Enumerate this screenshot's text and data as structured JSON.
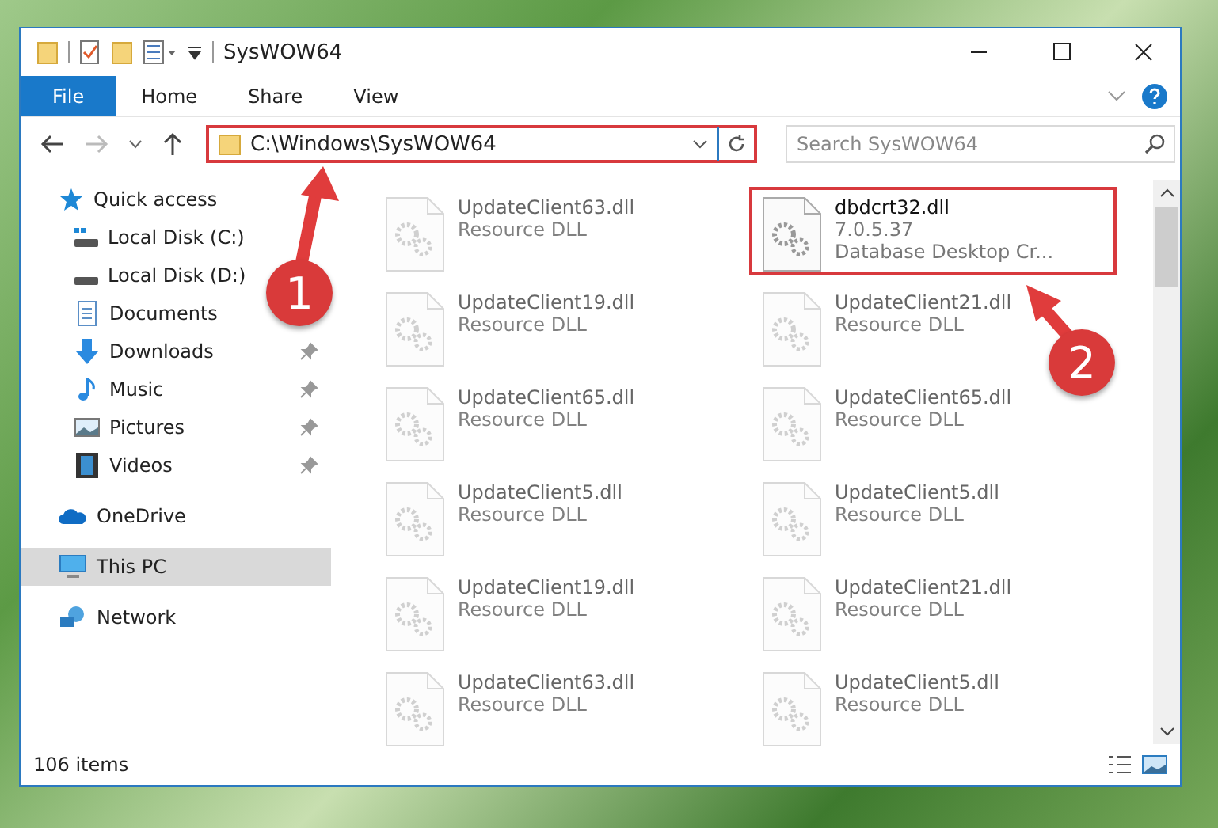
{
  "window": {
    "title": "SysWOW64"
  },
  "ribbon_tabs": [
    {
      "label": "File",
      "selected": true
    },
    {
      "label": "Home",
      "selected": false
    },
    {
      "label": "Share",
      "selected": false
    },
    {
      "label": "View",
      "selected": false
    }
  ],
  "address_bar": {
    "path": "C:\\Windows\\SysWOW64",
    "highlighted": true
  },
  "search": {
    "placeholder": "Search SysWOW64"
  },
  "sidebar": {
    "items": [
      {
        "label": "Quick access",
        "kind": "star",
        "selected": false,
        "children": [
          {
            "label": "Local Disk (C:)",
            "kind": "drive-c",
            "pinned": false,
            "selected": false
          },
          {
            "label": "Local Disk (D:)",
            "kind": "drive",
            "pinned": false,
            "selected": false
          },
          {
            "label": "Documents",
            "kind": "documents",
            "pinned": false,
            "selected": false
          },
          {
            "label": "Downloads",
            "kind": "downloads",
            "pinned": true,
            "selected": false
          },
          {
            "label": "Music",
            "kind": "music",
            "pinned": true,
            "selected": false
          },
          {
            "label": "Pictures",
            "kind": "pictures",
            "pinned": true,
            "selected": false
          },
          {
            "label": "Videos",
            "kind": "videos",
            "pinned": true,
            "selected": false
          }
        ]
      },
      {
        "label": "OneDrive",
        "kind": "cloud",
        "selected": false
      },
      {
        "label": "This PC",
        "kind": "pc",
        "selected": true
      },
      {
        "label": "Network",
        "kind": "network",
        "selected": false
      }
    ]
  },
  "files": [
    {
      "name": "UpdateClient63.dll",
      "details": [
        "Resource DLL"
      ],
      "kind": "faded"
    },
    {
      "name": "dbdcrt32.dll",
      "details": [
        "7.0.5.37",
        "Database Desktop Cr..."
      ],
      "kind": "focused"
    },
    {
      "name": "UpdateClient19.dll",
      "details": [
        "Resource DLL"
      ],
      "kind": "faded"
    },
    {
      "name": "UpdateClient21.dll",
      "details": [
        "Resource DLL"
      ],
      "kind": "faded"
    },
    {
      "name": "UpdateClient65.dll",
      "details": [
        "Resource DLL"
      ],
      "kind": "faded"
    },
    {
      "name": "UpdateClient65.dll",
      "details": [
        "Resource DLL"
      ],
      "kind": "faded"
    },
    {
      "name": "UpdateClient5.dll",
      "details": [
        "Resource DLL"
      ],
      "kind": "faded"
    },
    {
      "name": "UpdateClient5.dll",
      "details": [
        "Resource DLL"
      ],
      "kind": "faded"
    },
    {
      "name": "UpdateClient19.dll",
      "details": [
        "Resource DLL"
      ],
      "kind": "faded"
    },
    {
      "name": "UpdateClient21.dll",
      "details": [
        "Resource DLL"
      ],
      "kind": "faded"
    },
    {
      "name": "UpdateClient63.dll",
      "details": [
        "Resource DLL"
      ],
      "kind": "faded"
    },
    {
      "name": "UpdateClient5.dll",
      "details": [
        "Resource DLL"
      ],
      "kind": "faded"
    }
  ],
  "status_bar": {
    "item_count": "106 items"
  },
  "annotations": [
    {
      "label": "1"
    },
    {
      "label": "2"
    }
  ]
}
